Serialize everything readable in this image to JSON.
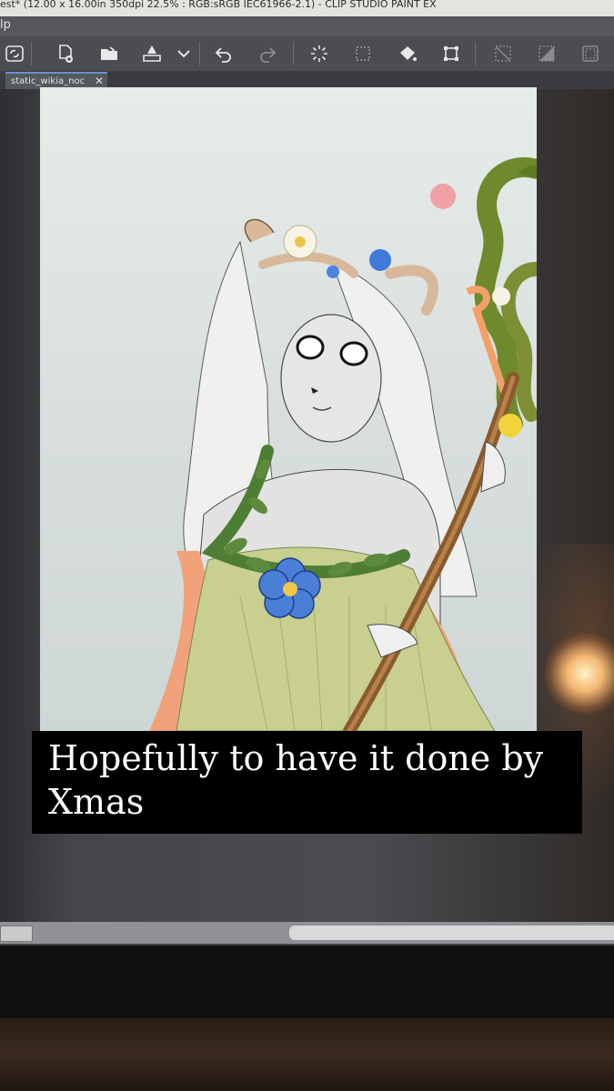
{
  "window": {
    "title": "est* (12.00 x 16.00in 350dpi 22.5% : RGB:sRGB IEC61966-2.1) - CLIP STUDIO PAINT EX"
  },
  "menubar": {
    "visible_text": "lp"
  },
  "toolbar": {
    "buttons": [
      {
        "name": "clip-studio-logo",
        "icon": "clip-icon"
      },
      {
        "name": "new-file",
        "icon": "new-file-icon"
      },
      {
        "name": "open",
        "icon": "folder-open-icon"
      },
      {
        "name": "save",
        "icon": "save-tray-icon"
      },
      {
        "name": "save-dropdown",
        "icon": "chevron-down-icon"
      },
      {
        "name": "undo",
        "icon": "undo-icon"
      },
      {
        "name": "redo",
        "icon": "redo-icon"
      },
      {
        "name": "clear",
        "icon": "clear-burst-icon"
      },
      {
        "name": "clear-outside-selection",
        "icon": "dotted-square-icon"
      },
      {
        "name": "fill",
        "icon": "fill-bucket-icon"
      },
      {
        "name": "transform",
        "icon": "transform-icon"
      },
      {
        "name": "deselect",
        "icon": "deselect-icon"
      },
      {
        "name": "invert-selection",
        "icon": "invert-selection-icon"
      },
      {
        "name": "show-selection",
        "icon": "selection-box-icon"
      }
    ]
  },
  "tabs": [
    {
      "label": "static_wikia_noc",
      "close": "✕",
      "active": true
    }
  ],
  "overlay": {
    "caption": "Hopefully to have it done by Xmas"
  },
  "colors": {
    "accent_tab": "#6b8fd6",
    "canvas_bg": "#dfe5e3",
    "dress": "#c9cf8f",
    "sash": "#f2a27a",
    "leaves": "#5d8a3c",
    "flower_blue": "#4a7fd6",
    "caption_bg": "#000000"
  }
}
